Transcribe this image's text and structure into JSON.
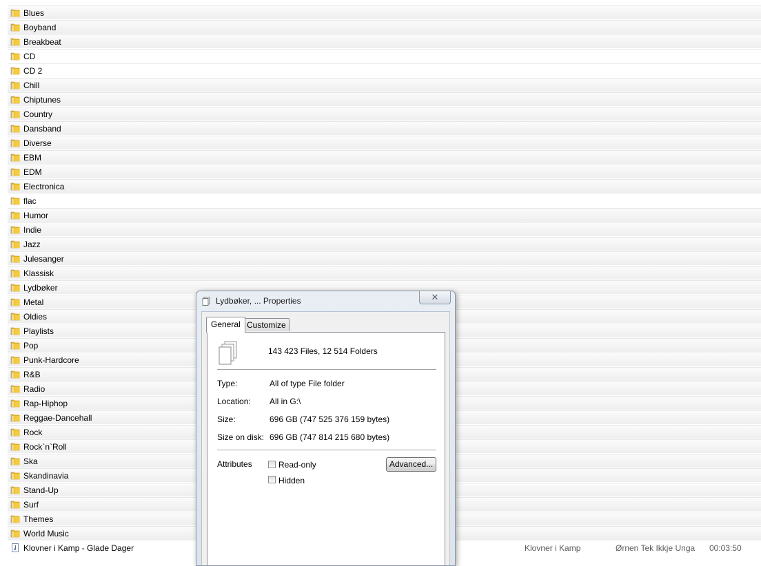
{
  "folders": [
    "Blues",
    "Boyband",
    "Breakbeat",
    "CD",
    "CD 2",
    "Chill",
    "Chiptunes",
    "Country",
    "Dansband",
    "Diverse",
    "EBM",
    "EDM",
    "Electronica",
    "flac",
    "Humor",
    "Indie",
    "Jazz",
    "Julesanger",
    "Klassisk",
    "Lydbøker",
    "Metal",
    "Oldies",
    "Playlists",
    "Pop",
    "Punk-Hardcore",
    "R&B",
    "Radio",
    "Rap-Hiphop",
    "Reggae-Dancehall",
    "Rock",
    "Rock`n`Roll",
    "Ska",
    "Skandinavia",
    "Stand-Up",
    "Surf",
    "Themes",
    "World Music"
  ],
  "track": {
    "title": "Klovner i Kamp - Glade Dager",
    "artist": "Klovner i Kamp",
    "album": "Ørnen Tek Ikkje Unga",
    "duration": "00:03:50"
  },
  "dialog": {
    "title": "Lydbøker, ... Properties",
    "close_glyph": "✕",
    "tabs": [
      "General",
      "Customize"
    ],
    "summary": "143 423 Files, 12 514 Folders",
    "properties": [
      {
        "label": "Type:",
        "value": "All of type File folder"
      },
      {
        "label": "Location:",
        "value": "All in G:\\"
      },
      {
        "label": "Size:",
        "value": "696 GB (747 525 376 159 bytes)"
      },
      {
        "label": "Size on disk:",
        "value": "696 GB (747 814 215 680 bytes)"
      }
    ],
    "attributes_label": "Attributes",
    "read_only_label": "Read-only",
    "hidden_label": "Hidden",
    "advanced_label": "Advanced..."
  },
  "icons": {
    "folder": "folder-icon",
    "music_file": "music-file-icon",
    "files": "files-stack-icon",
    "close": "close-icon"
  },
  "colors": {
    "folder_yellow": "#e8b92e",
    "dialog_frame": "#dbe3ec"
  }
}
